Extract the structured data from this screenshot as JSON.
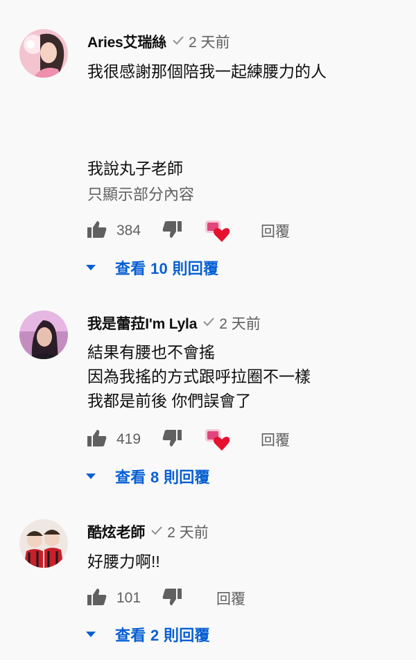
{
  "comments": [
    {
      "author": "Aries艾瑞絲",
      "time": "2 天前",
      "lines": [
        "我很感謝那個陪我一起練腰力的人",
        "",
        "",
        "",
        "我說丸子老師"
      ],
      "read_more": "只顯示部分內容",
      "likes": "384",
      "reply_label": "回覆",
      "view_replies": "查看 10 則回覆",
      "creator_hearted": true
    },
    {
      "author": "我是蕾菈I'm Lyla",
      "time": "2 天前",
      "lines": [
        "結果有腰也不會搖",
        "因為我搖的方式跟呼拉圈不一樣",
        "我都是前後 你們誤會了"
      ],
      "likes": "419",
      "reply_label": "回覆",
      "view_replies": "查看 8 則回覆",
      "creator_hearted": true
    },
    {
      "author": "酷炫老師",
      "time": "2 天前",
      "lines": [
        "好腰力啊!!"
      ],
      "likes": "101",
      "reply_label": "回覆",
      "view_replies": "查看 2 則回覆",
      "creator_hearted": false
    }
  ],
  "icons": {
    "like": "thumb-up-icon",
    "dislike": "thumb-down-icon",
    "verified": "check-icon",
    "expand": "caret-down-icon",
    "heart": "heart-icon"
  },
  "colors": {
    "accent": "#065fd4",
    "heart": "#e5112e",
    "secondary_text": "#606060"
  }
}
